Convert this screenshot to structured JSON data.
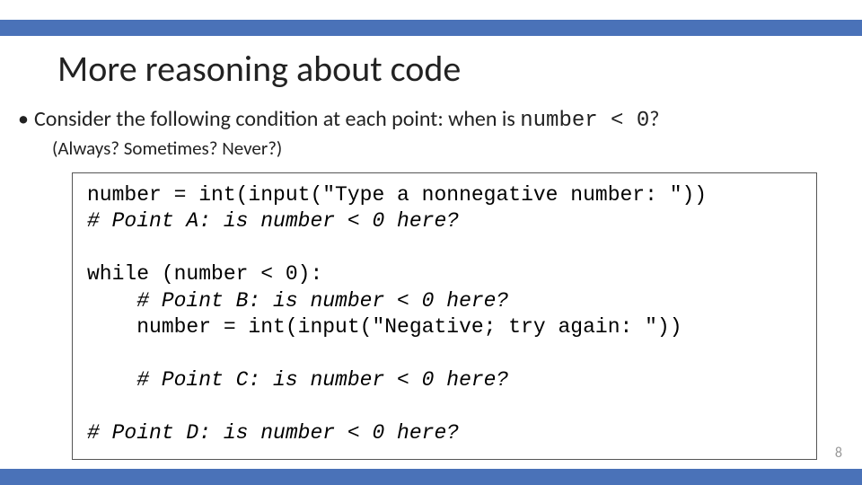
{
  "title": "More reasoning about code",
  "bullet": {
    "lead": "Consider the following condition at each point:   when is ",
    "code_inline": "number < 0",
    "tail": "?"
  },
  "subnote": "(Always?  Sometimes?  Never?)",
  "code": {
    "l1": "number = int(input(\"Type a nonnegative number: \"))",
    "l2": "# Point A: is number < 0 here?",
    "blank1": "",
    "l3": "while (number < 0):",
    "l4": "    # Point B: is number < 0 here?",
    "l5": "    number = int(input(\"Negative; try again: \"))",
    "blank2": "",
    "l6": "    # Point C: is number < 0 here?",
    "blank3": "",
    "l7": "# Point D: is number < 0 here?"
  },
  "page_number": "8"
}
